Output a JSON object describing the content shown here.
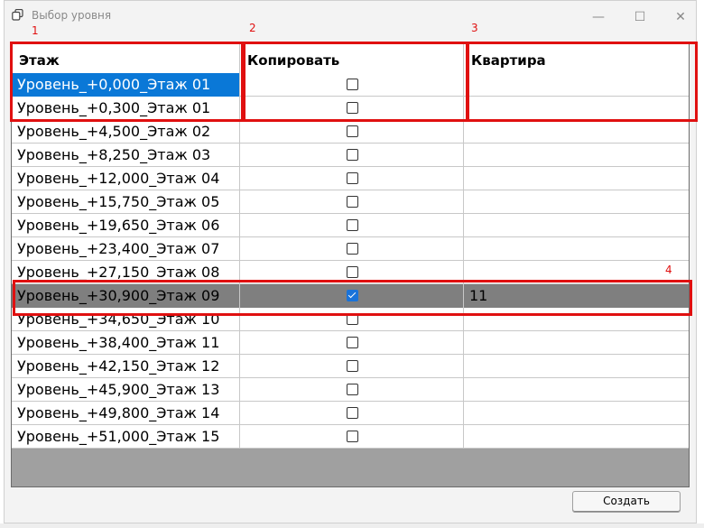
{
  "window": {
    "title": "Выбор уровня",
    "icon": "copy-levels-icon"
  },
  "controls": {
    "minimize": "—",
    "maximize": "☐",
    "close": "✕"
  },
  "columns": [
    "Этаж",
    "Копировать",
    "Квартира"
  ],
  "rows": [
    {
      "level": "Уровень_+0,000_Этаж 01",
      "copy": false,
      "apartment": "",
      "state": "selected"
    },
    {
      "level": "Уровень_+0,300_Этаж 01",
      "copy": false,
      "apartment": ""
    },
    {
      "level": "Уровень_+4,500_Этаж 02",
      "copy": false,
      "apartment": ""
    },
    {
      "level": "Уровень_+8,250_Этаж 03",
      "copy": false,
      "apartment": ""
    },
    {
      "level": "Уровень_+12,000_Этаж 04",
      "copy": false,
      "apartment": ""
    },
    {
      "level": "Уровень_+15,750_Этаж 05",
      "copy": false,
      "apartment": ""
    },
    {
      "level": "Уровень_+19,650_Этаж 06",
      "copy": false,
      "apartment": ""
    },
    {
      "level": "Уровень_+23,400_Этаж 07",
      "copy": false,
      "apartment": ""
    },
    {
      "level": "Уровень_+27,150_Этаж 08",
      "copy": false,
      "apartment": ""
    },
    {
      "level": "Уровень_+30,900_Этаж 09",
      "copy": true,
      "apartment": "11",
      "state": "highlighted"
    },
    {
      "level": "Уровень_+34,650_Этаж 10",
      "copy": false,
      "apartment": ""
    },
    {
      "level": "Уровень_+38,400_Этаж 11",
      "copy": false,
      "apartment": ""
    },
    {
      "level": "Уровень_+42,150_Этаж 12",
      "copy": false,
      "apartment": ""
    },
    {
      "level": "Уровень_+45,900_Этаж 13",
      "copy": false,
      "apartment": ""
    },
    {
      "level": "Уровень_+49,800_Этаж 14",
      "copy": false,
      "apartment": ""
    },
    {
      "level": "Уровень_+51,000_Этаж 15",
      "copy": false,
      "apartment": ""
    }
  ],
  "annotations": [
    "1",
    "2",
    "3",
    "4"
  ],
  "buttons": {
    "create": "Создать"
  },
  "colors": {
    "selection": "#0a78d7",
    "highlight_row": "#7f7f7f",
    "annotation": "#e01010",
    "checkbox_on": "#1a73d9"
  }
}
